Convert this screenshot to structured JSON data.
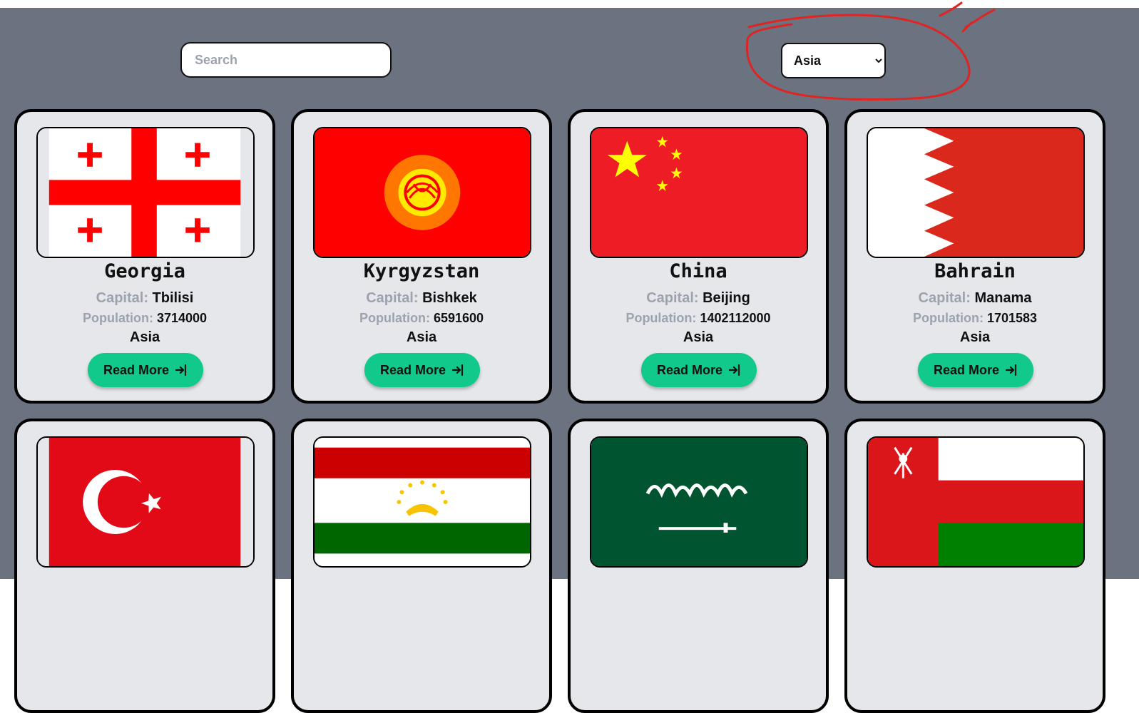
{
  "search": {
    "placeholder": "Search",
    "value": ""
  },
  "filter": {
    "selected": "Asia",
    "options": [
      "Asia"
    ]
  },
  "labels": {
    "capital": "Capital:",
    "population": "Population:",
    "read_more": "Read More"
  },
  "icons": {
    "read_more": "arrow-right-to-bracket-icon",
    "select": "chevron-down-icon"
  },
  "colors": {
    "background": "#6b7280",
    "card": "#e5e7eb",
    "button": "#10c98a",
    "annotation": "#e02424"
  },
  "countries": [
    {
      "name": "Georgia",
      "capital": "Tbilisi",
      "population": "3714000",
      "region": "Asia",
      "flag": "georgia-flag"
    },
    {
      "name": "Kyrgyzstan",
      "capital": "Bishkek",
      "population": "6591600",
      "region": "Asia",
      "flag": "kyrgyzstan-flag"
    },
    {
      "name": "China",
      "capital": "Beijing",
      "population": "1402112000",
      "region": "Asia",
      "flag": "china-flag"
    },
    {
      "name": "Bahrain",
      "capital": "Manama",
      "population": "1701583",
      "region": "Asia",
      "flag": "bahrain-flag"
    },
    {
      "flag": "turkey-flag"
    },
    {
      "flag": "tajikistan-flag"
    },
    {
      "flag": "saudi-arabia-flag"
    },
    {
      "flag": "oman-flag"
    }
  ]
}
